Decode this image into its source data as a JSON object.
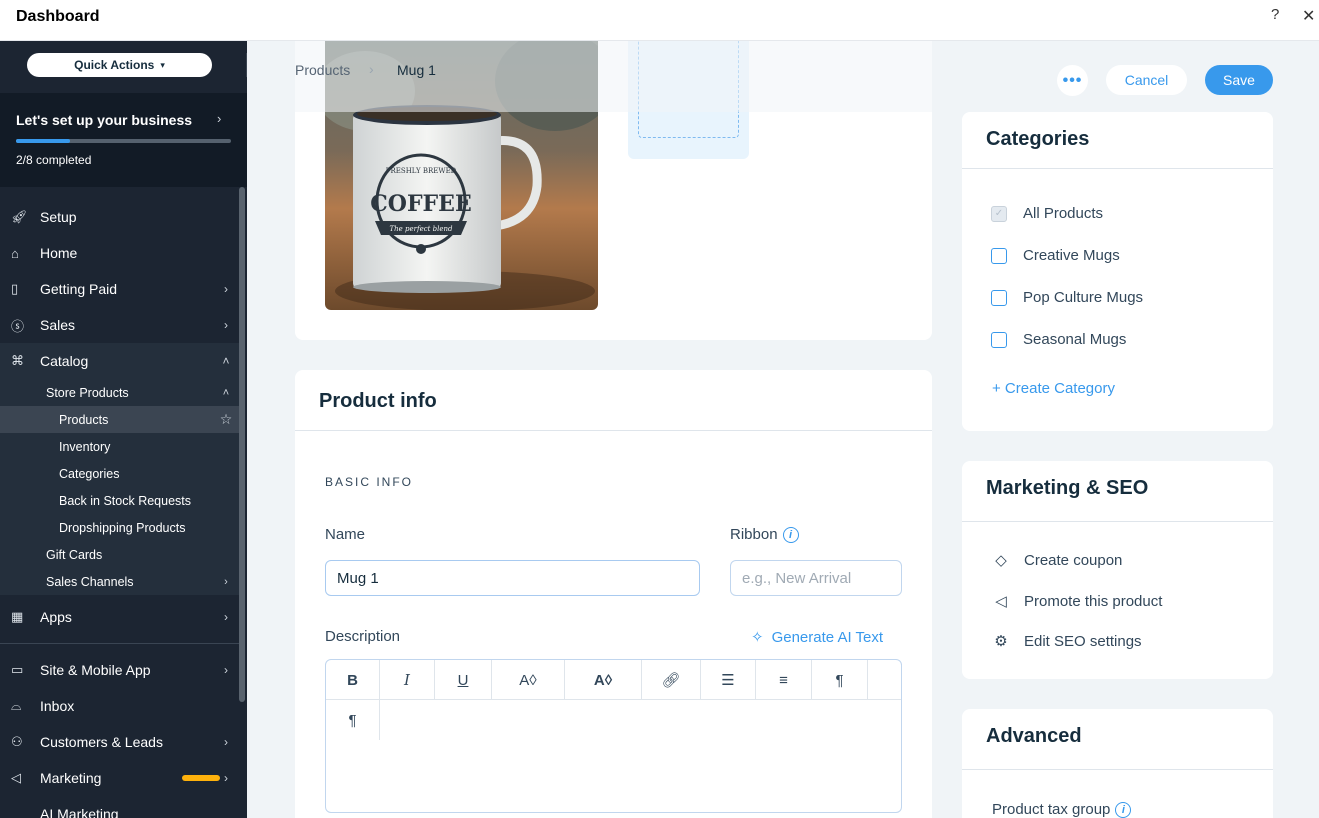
{
  "topbar": {
    "title": "Dashboard",
    "help": "?",
    "close": "✕"
  },
  "sidebar": {
    "quick_actions": "Quick Actions",
    "setup": {
      "title": "Let's set up your business",
      "progress_text": "2/8 completed",
      "progress": 0.25
    },
    "items": {
      "setup": "Setup",
      "home": "Home",
      "getting_paid": "Getting Paid",
      "sales": "Sales",
      "catalog": "Catalog",
      "store_products": "Store Products",
      "products": "Products",
      "inventory": "Inventory",
      "categories": "Categories",
      "back_in_stock": "Back in Stock Requests",
      "dropshipping": "Dropshipping Products",
      "gift_cards": "Gift Cards",
      "sales_channels": "Sales Channels",
      "apps": "Apps",
      "site_mobile": "Site & Mobile App",
      "inbox": "Inbox",
      "customers": "Customers & Leads",
      "marketing": "Marketing",
      "ai_marketing": "AI Marketing"
    }
  },
  "header": {
    "breadcrumb_root": "Products",
    "breadcrumb_current": "Mug 1",
    "more": "•••",
    "cancel": "Cancel",
    "save": "Save"
  },
  "product_info": {
    "title": "Product info",
    "section": "BASIC INFO",
    "name_label": "Name",
    "name_value": "Mug 1",
    "ribbon_label": "Ribbon",
    "ribbon_placeholder": "e.g., New Arrival",
    "description_label": "Description",
    "generate_ai": "Generate AI Text"
  },
  "image": {
    "top_text": "FRESHLY BREWED",
    "main_text": "COFFEE",
    "script_text": "The perfect blend"
  },
  "categories": {
    "title": "Categories",
    "items": [
      {
        "label": "All Products",
        "checked": true
      },
      {
        "label": "Creative Mugs",
        "checked": false
      },
      {
        "label": "Pop Culture Mugs",
        "checked": false
      },
      {
        "label": "Seasonal Mugs",
        "checked": false
      }
    ],
    "create": "+ Create Category"
  },
  "marketing": {
    "title": "Marketing & SEO",
    "items": [
      "Create coupon",
      "Promote this product",
      "Edit SEO settings"
    ]
  },
  "advanced": {
    "title": "Advanced",
    "tax_label": "Product tax group"
  },
  "colors": {
    "accent": "#3899ec",
    "sidebar": "#1c2532",
    "background": "#f0f4f7"
  }
}
